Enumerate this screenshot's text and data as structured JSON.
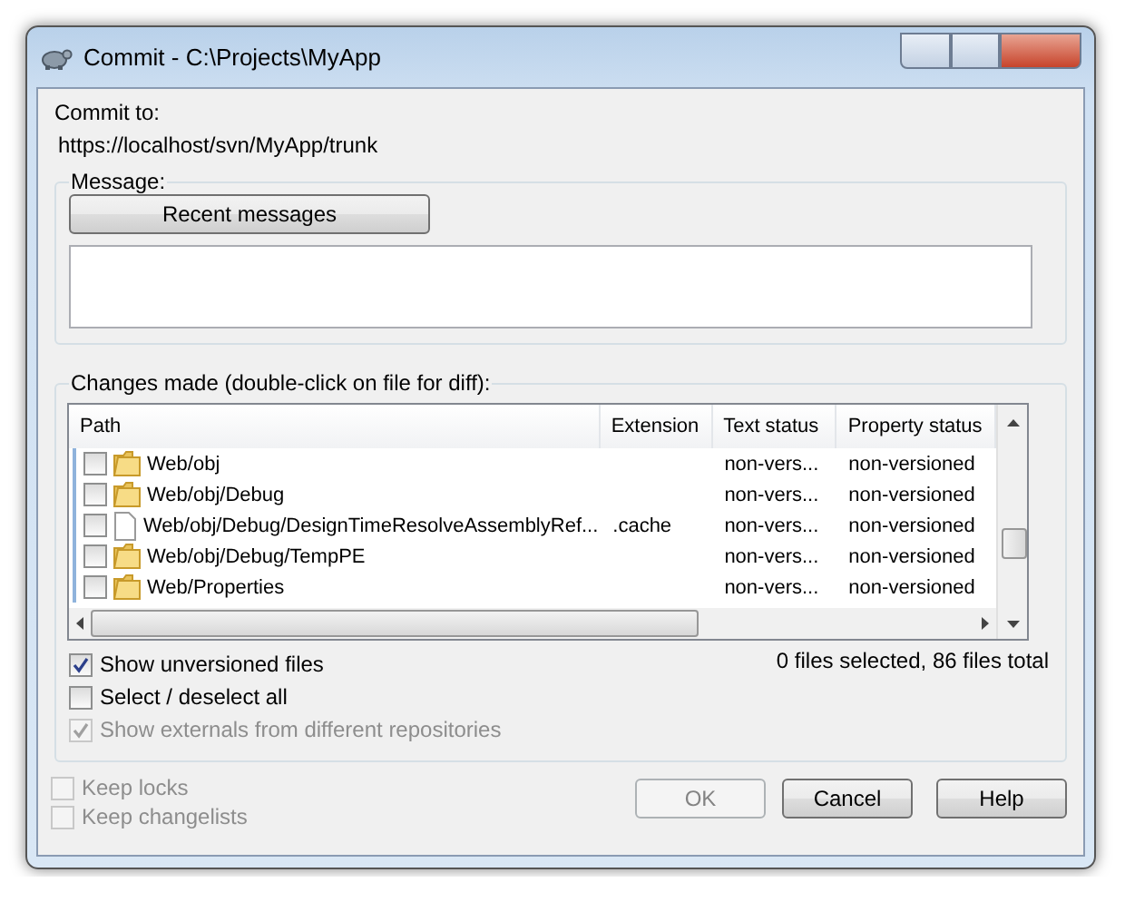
{
  "window": {
    "title": "Commit - C:\\Projects\\MyApp"
  },
  "commit_to": {
    "label": "Commit to:",
    "url": "https://localhost/svn/MyApp/trunk"
  },
  "message": {
    "label": "Message:",
    "recent_button": "Recent messages"
  },
  "changes": {
    "label": "Changes made (double-click on file for diff):",
    "columns": [
      "Path",
      "Extension",
      "Text status",
      "Property status"
    ],
    "rows": [
      {
        "kind": "folder",
        "checked": false,
        "path": "Web/obj",
        "text_status": "non-vers...",
        "property_status": "non-versioned"
      },
      {
        "kind": "folder",
        "checked": false,
        "path": "Web/obj/Debug",
        "text_status": "non-vers...",
        "property_status": "non-versioned"
      },
      {
        "kind": "file",
        "checked": false,
        "path": "Web/obj/Debug/DesignTimeResolveAssemblyRef...",
        "extension": ".cache",
        "text_status": "non-vers...",
        "property_status": "non-versioned"
      },
      {
        "kind": "folder",
        "checked": false,
        "path": "Web/obj/Debug/TempPE",
        "text_status": "non-vers...",
        "property_status": "non-versioned"
      },
      {
        "kind": "folder",
        "checked": false,
        "path": "Web/Properties",
        "text_status": "non-vers...",
        "property_status": "non-versioned"
      }
    ],
    "options": [
      {
        "label": "Show unversioned files",
        "checked": true,
        "disabled": false
      },
      {
        "label": "Select / deselect all",
        "checked": false,
        "disabled": false
      },
      {
        "label": "Show externals from different repositories",
        "checked": true,
        "disabled": true
      }
    ],
    "summary": "0 files selected, 86 files total"
  },
  "keep_options": [
    {
      "label": "Keep locks",
      "checked": false,
      "disabled": true
    },
    {
      "label": "Keep changelists",
      "checked": false,
      "disabled": true
    }
  ],
  "buttons": [
    {
      "label": "OK",
      "disabled": true
    },
    {
      "label": "Cancel",
      "disabled": false
    },
    {
      "label": "Help",
      "disabled": false
    }
  ]
}
